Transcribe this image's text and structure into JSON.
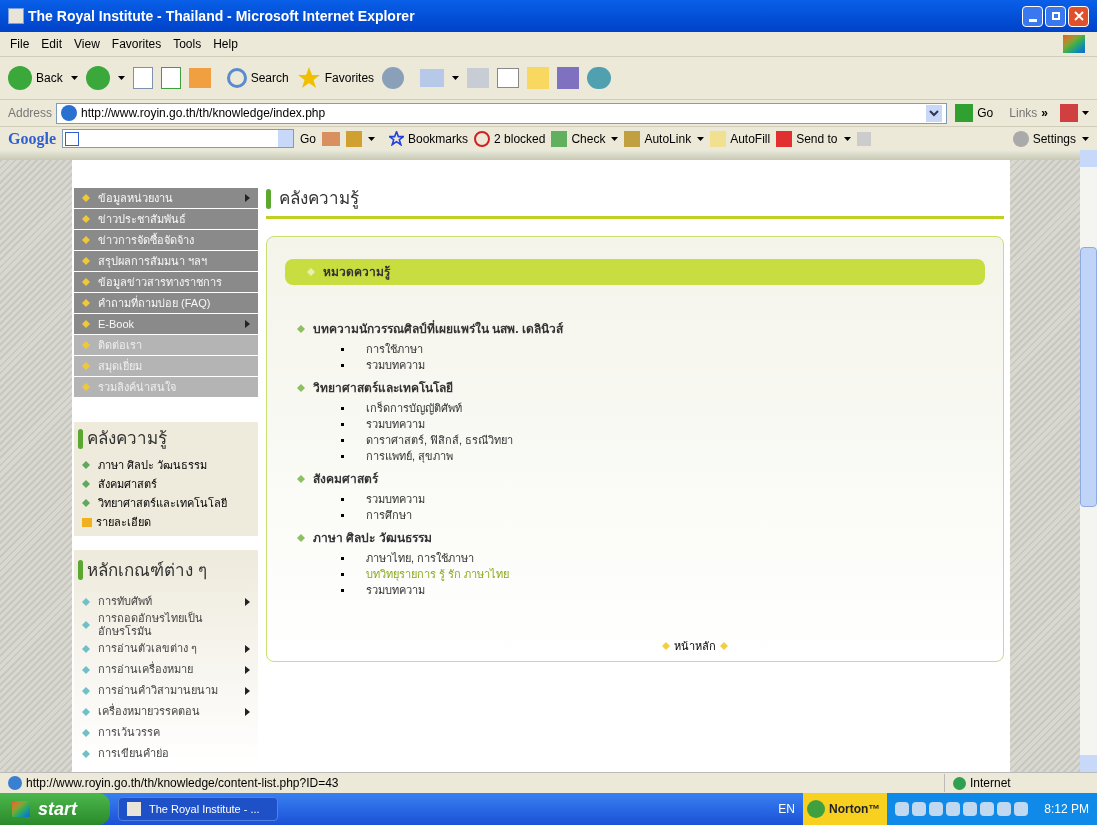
{
  "window": {
    "title": "The Royal Institute - Thailand - Microsoft Internet Explorer"
  },
  "menu": [
    "File",
    "Edit",
    "View",
    "Favorites",
    "Tools",
    "Help"
  ],
  "toolbar": {
    "back": "Back",
    "search": "Search",
    "favorites": "Favorites"
  },
  "address": {
    "label": "Address",
    "url": "http://www.royin.go.th/th/knowledge/index.php",
    "go": "Go",
    "links": "Links",
    "chevron": "»"
  },
  "google_bar": {
    "logo": "Google",
    "go": "Go",
    "bookmarks": "Bookmarks",
    "blocked": "2 blocked",
    "check": "Check",
    "autolink": "AutoLink",
    "autofill": "AutoFill",
    "send_to": "Send to",
    "settings": "Settings"
  },
  "sidebar": {
    "menu": [
      {
        "label": "ข้อมูลหน่วยงาน",
        "arrow": true,
        "kind": "dark"
      },
      {
        "label": "ข่าวประชาสัมพันธ์",
        "arrow": false,
        "kind": "dark"
      },
      {
        "label": "ข่าวการจัดซื้อจัดจ้าง",
        "arrow": false,
        "kind": "dark"
      },
      {
        "label": "สรุปผลการสัมมนา ฯลฯ",
        "arrow": false,
        "kind": "dark"
      },
      {
        "label": "ข้อมูลข่าวสารทางราชการ",
        "arrow": false,
        "kind": "dark"
      },
      {
        "label": "คำถามที่ถามบ่อย (FAQ)",
        "arrow": false,
        "kind": "dark"
      },
      {
        "label": "E-Book",
        "arrow": true,
        "kind": "dark"
      },
      {
        "label": "ติดต่อเรา",
        "arrow": false,
        "kind": "light"
      },
      {
        "label": "สมุดเยี่ยม",
        "arrow": false,
        "kind": "light"
      },
      {
        "label": "รวมลิงค์น่าสนใจ",
        "arrow": false,
        "kind": "light"
      }
    ],
    "knowledge": {
      "title": "คลังความรู้",
      "items": [
        "ภาษา ศิลปะ วัฒนธรรม",
        "สังคมศาสตร์",
        "วิทยาศาสตร์และเทคโนโลยี"
      ],
      "more": "รายละเอียด"
    },
    "principles": {
      "title": "หลักเกณฑ์ต่าง ๆ",
      "items": [
        {
          "label": "การทับศัพท์",
          "arrow": true
        },
        {
          "label": "การถอดอักษรไทยเป็นอักษรโรมัน",
          "arrow": false
        },
        {
          "label": "การอ่านตัวเลขต่าง ๆ",
          "arrow": true
        },
        {
          "label": "การอ่านเครื่องหมาย",
          "arrow": true
        },
        {
          "label": "การอ่านคำวิสามานยนาม",
          "arrow": true
        },
        {
          "label": "เครื่องหมายวรรคตอน",
          "arrow": true
        },
        {
          "label": "การเว้นวรรค",
          "arrow": false
        },
        {
          "label": "การเขียนคำย่อ",
          "arrow": false
        }
      ]
    }
  },
  "main": {
    "title": "คลังความรู้",
    "category_bar": "หมวดความรู้",
    "sections": [
      {
        "title": "บทความนักวรรณศิลป์ที่เผยแพร่ใน นสพ. เดลินิวส์",
        "items": [
          {
            "label": "การใช้ภาษา",
            "highlighted": false
          },
          {
            "label": "รวมบทความ",
            "highlighted": false
          }
        ]
      },
      {
        "title": "วิทยาศาสตร์และเทคโนโลยี",
        "items": [
          {
            "label": "เกร็ดการบัญญัติศัพท์",
            "highlighted": false
          },
          {
            "label": "รวมบทความ",
            "highlighted": false
          },
          {
            "label": "ดาราศาสตร์, ฟิสิกส์, ธรณีวิทยา",
            "highlighted": false
          },
          {
            "label": "การแพทย์, สุขภาพ",
            "highlighted": false
          }
        ]
      },
      {
        "title": "สังคมศาสตร์",
        "items": [
          {
            "label": "รวมบทความ",
            "highlighted": false
          },
          {
            "label": "การศึกษา",
            "highlighted": false
          }
        ]
      },
      {
        "title": "ภาษา ศิลปะ วัฒนธรรม",
        "items": [
          {
            "label": "ภาษาไทย, การใช้ภาษา",
            "highlighted": false
          },
          {
            "label": "บทวิทยุรายการ รู้ รัก ภาษาไทย",
            "highlighted": true
          },
          {
            "label": "รวมบทความ",
            "highlighted": false
          }
        ]
      }
    ],
    "home_link": "หน้าหลัก"
  },
  "status_bar": {
    "url": "http://www.royin.go.th/th/knowledge/content-list.php?ID=43",
    "zone": "Internet"
  },
  "taskbar": {
    "start": "start",
    "task": "The Royal Institute - ...",
    "lang": "EN",
    "norton": "Norton™",
    "clock": "8:12 PM"
  }
}
